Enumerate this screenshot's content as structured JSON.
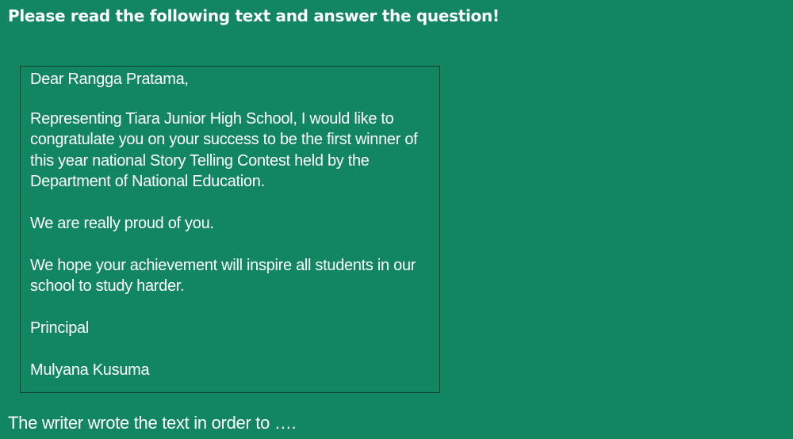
{
  "instruction": "Please read the following text and answer the question!",
  "letter": {
    "salutation": "Dear Rangga Pratama,",
    "paragraphs": [
      "Representing Tiara Junior High School, I would like to congratulate you on your success to be the first winner of this year national Story Telling Contest held by the Department of National Education.",
      "We are really proud of you.",
      "We hope your achievement will inspire all students in our school to study harder."
    ],
    "closing_title": "Principal",
    "signature": "Mulyana Kusuma"
  },
  "question": "The writer wrote the text in order to …."
}
